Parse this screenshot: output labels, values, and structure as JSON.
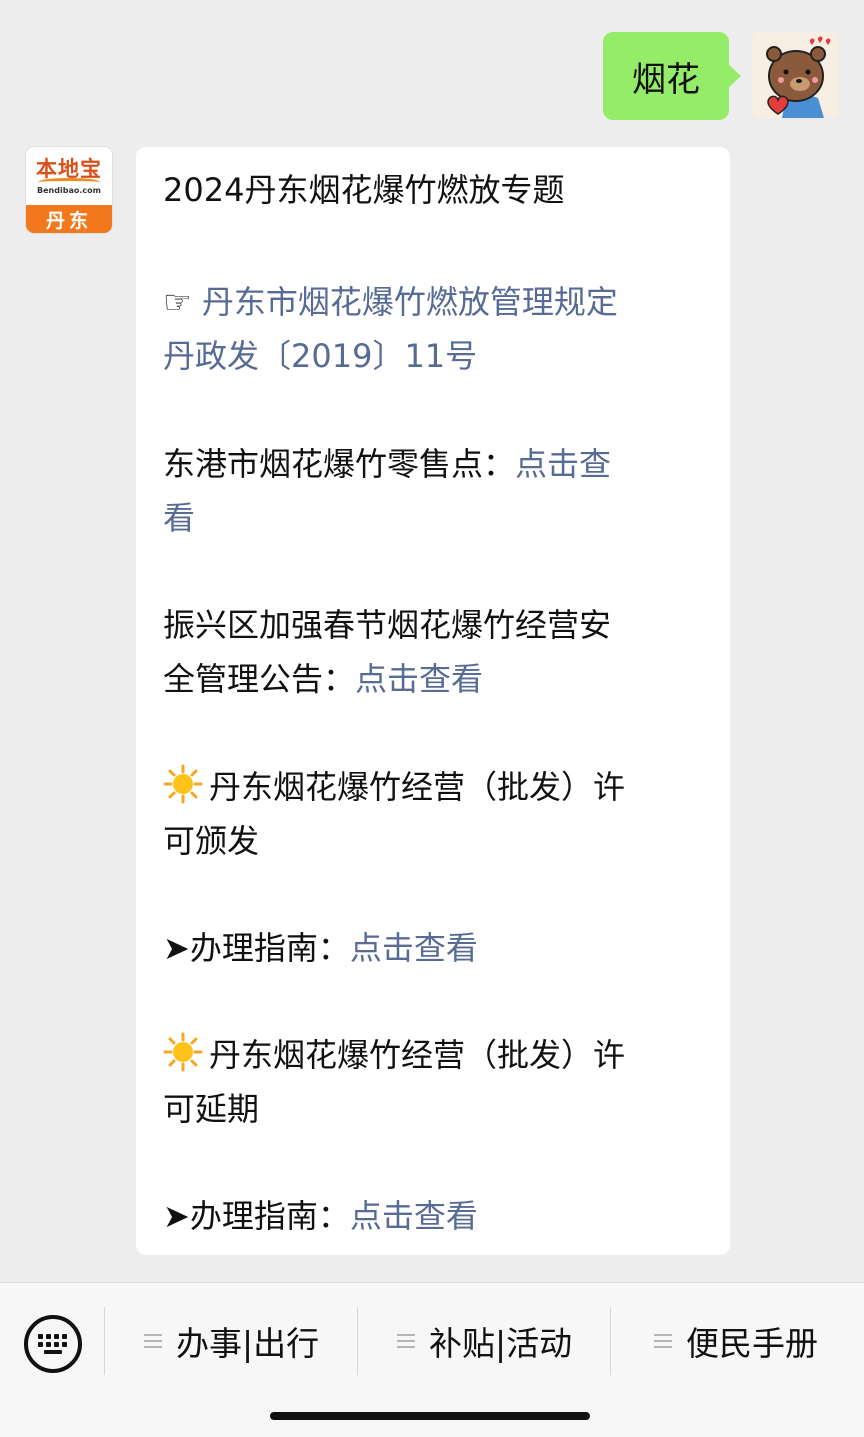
{
  "outgoing": {
    "text": "烟花"
  },
  "bot": {
    "logo_text": "本地宝",
    "logo_sub": "Bendibao.com",
    "city": "丹东"
  },
  "message": {
    "title": "2024丹东烟花爆竹燃放专题",
    "regulation_prefix": "☞ ",
    "regulation_link_line1": "丹东市烟花爆竹燃放管理规定",
    "regulation_link_line2": "丹政发〔2019〕11号",
    "donggang_text": "东港市烟花爆竹零售点：",
    "donggang_link_line1": "点击查",
    "donggang_link_line2": "看",
    "zhenxing_line1": "振兴区加强春节烟花爆竹经营安",
    "zhenxing_line2": "全管理公告：",
    "zhenxing_link": "点击查看",
    "issue_line1": "丹东烟花爆竹经营（批发）许",
    "issue_line2": "可颁发",
    "guide1_prefix": "➤办理指南：",
    "guide1_link": "点击查看",
    "extend_line1": "丹东烟花爆竹经营（批发）许",
    "extend_line2": "可延期",
    "guide2_prefix": "➤办理指南：",
    "guide2_link": "点击查看"
  },
  "menu": {
    "items": [
      {
        "label": "办事|出行"
      },
      {
        "label": "补贴|活动"
      },
      {
        "label": "便民手册"
      }
    ]
  },
  "colors": {
    "link": "#576b95",
    "outgoing_bubble": "#95ec69",
    "brand_orange": "#f3781c"
  },
  "icons": [
    "keyboard-icon",
    "menu-list-icon",
    "sun-icon"
  ]
}
